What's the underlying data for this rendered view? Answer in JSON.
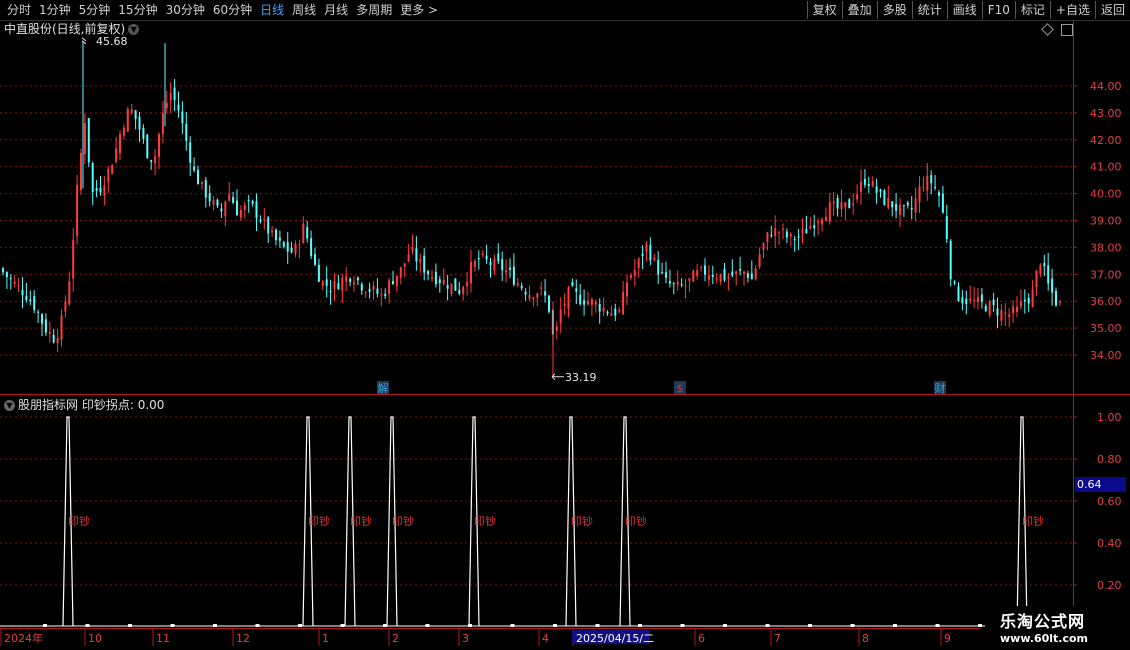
{
  "toolbar": {
    "periods": [
      {
        "label": "分时"
      },
      {
        "label": "1分钟"
      },
      {
        "label": "5分钟"
      },
      {
        "label": "15分钟"
      },
      {
        "label": "30分钟"
      },
      {
        "label": "60分钟"
      },
      {
        "label": "日线",
        "active": true
      },
      {
        "label": "周线"
      },
      {
        "label": "月线"
      },
      {
        "label": "多周期"
      },
      {
        "label": "更多 >"
      }
    ],
    "actions": [
      {
        "label": "复权"
      },
      {
        "label": "叠加"
      },
      {
        "label": "多股"
      },
      {
        "label": "统计"
      },
      {
        "label": "画线"
      },
      {
        "label": "F10"
      },
      {
        "label": "标记"
      },
      {
        "label": "+自选"
      },
      {
        "label": "返回"
      }
    ]
  },
  "main_chart": {
    "title": "中直股份(日线,前复权)",
    "high_label": "45.68",
    "low_label": "33.19",
    "event_marks": [
      {
        "text": "解",
        "color": "#3aa0d8"
      },
      {
        "text": "$",
        "color": "#e03030"
      },
      {
        "text": "财",
        "color": "#3aa0d8"
      }
    ],
    "y_ticks": [
      "44.00",
      "43.00",
      "42.00",
      "41.00",
      "40.00",
      "39.00",
      "38.00",
      "37.00",
      "36.00",
      "35.00",
      "34.00"
    ]
  },
  "indicator": {
    "title": "股朋指标网",
    "series_name": "印钞拐点",
    "series_value": "0.00",
    "signal_label": "印钞",
    "y_ticks": [
      "1.00",
      "0.80",
      "0.60",
      "0.40",
      "0.20"
    ],
    "cursor_value": "0.64"
  },
  "x_axis": {
    "labels": [
      "2024年",
      "10",
      "11",
      "12",
      "1",
      "2",
      "3",
      "4",
      "2025/04/15/二",
      "6",
      "7",
      "8",
      "9"
    ]
  },
  "watermark": {
    "name": "乐淘公式网",
    "url": "www.60lt.com"
  },
  "colors": {
    "up": "#ff3b3b",
    "down": "#54ffff",
    "grid": "#8a1010",
    "axis": "#b01818",
    "signal": "#ffffff",
    "accent": "#3fa3ff"
  }
}
